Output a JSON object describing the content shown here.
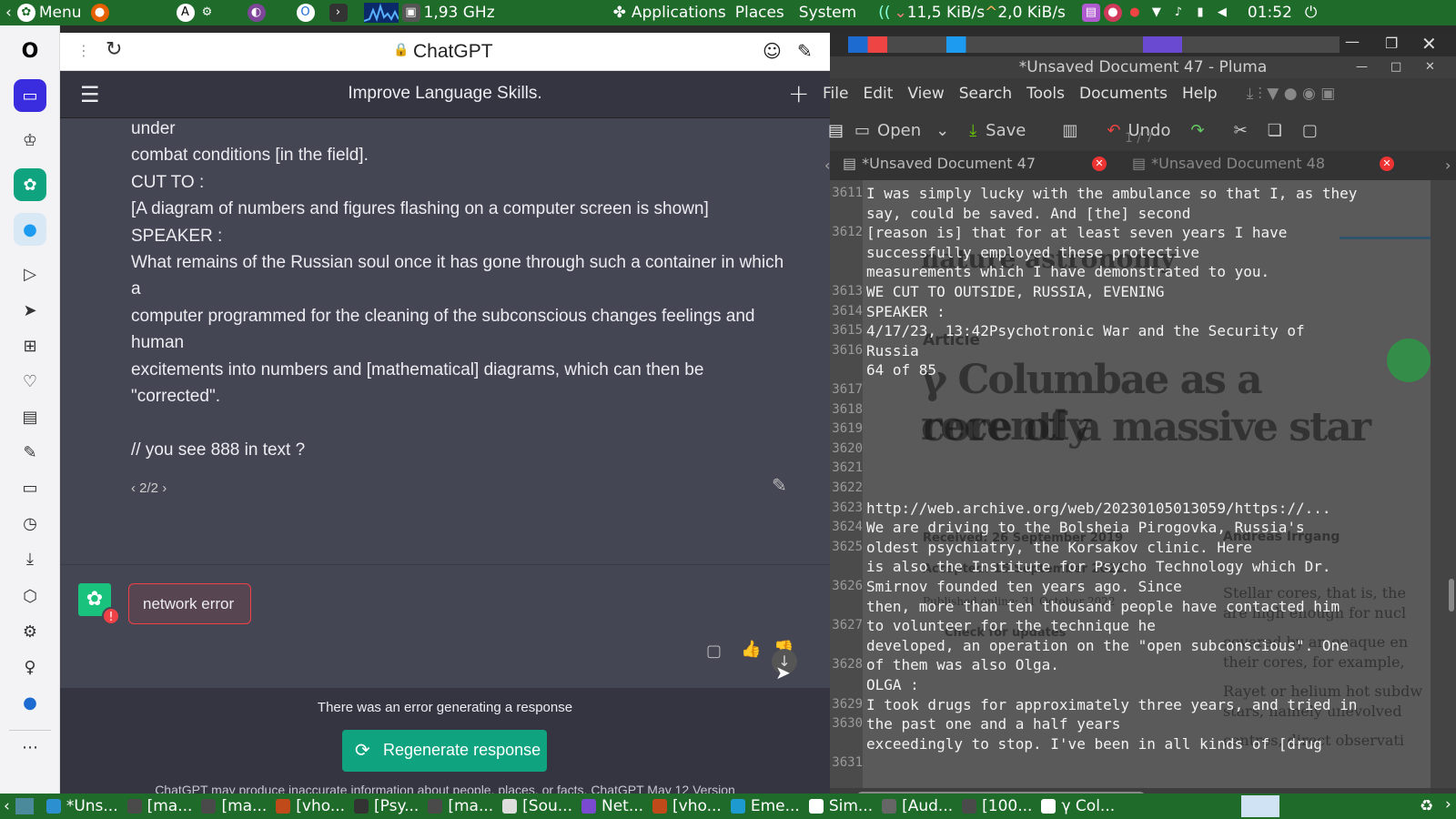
{
  "top_panel": {
    "menu_label": "Menu",
    "cpu_freq": "1,93 GHz",
    "applications": "Applications",
    "places": "Places",
    "system": "System",
    "net_down": "11,5 KiB/s",
    "net_up": "2,0 KiB/s",
    "clock": "01:52"
  },
  "browser": {
    "page_title": "ChatGPT",
    "chat_title": "Improve Language Skills.",
    "message_lines": [
      "under",
      "combat conditions [in the field].",
      "CUT TO :",
      "[A diagram of numbers and figures flashing on a computer screen is shown]",
      "SPEAKER :",
      "What remains of the Russian soul once it has gone through such a container in which",
      "a",
      "computer programmed for the cleaning of the subconscious changes feelings and",
      "human",
      "excitements into numbers and [mathematical] diagrams, which can then be",
      "\"corrected\".",
      "",
      "// you see 888 in text ?"
    ],
    "pager": "2/2",
    "error_badge": "network error",
    "error_notice": "There was an error generating a response",
    "regenerate_label": "Regenerate response",
    "disclaimer": "ChatGPT may produce inaccurate information about people, places, or facts.",
    "version_link": "ChatGPT May 12 Version"
  },
  "pluma": {
    "title": "*Unsaved Document 47 - Pluma",
    "menu": [
      "File",
      "Edit",
      "View",
      "Search",
      "Tools",
      "Documents",
      "Help"
    ],
    "open_label": "Open",
    "save_label": "Save",
    "undo_label": "Undo",
    "page_indicator": "1 / 7",
    "doc_tab_1": "*Unsaved Document 47",
    "doc_tab_2": "*Unsaved Document 48",
    "lines": [
      {
        "n": "3611",
        "t": "I was simply lucky with the ambulance so that I, as they"
      },
      {
        "n": "",
        "t": "say, could be saved. And [the] second"
      },
      {
        "n": "3612",
        "t": "[reason is] that for at least seven years I have"
      },
      {
        "n": "",
        "t": "successfully employed these protective"
      },
      {
        "n": "",
        "t": "measurements which I have demonstrated to you."
      },
      {
        "n": "3613",
        "t": "WE CUT TO OUTSIDE, RUSSIA, EVENING"
      },
      {
        "n": "3614",
        "t": "SPEAKER :"
      },
      {
        "n": "3615",
        "t": "4/17/23, 13:42Psychotronic War and the Security of"
      },
      {
        "n": "3616",
        "t": "Russia"
      },
      {
        "n": "",
        "t": "64 of 85"
      },
      {
        "n": "3617",
        "t": ""
      },
      {
        "n": "3618",
        "t": ""
      },
      {
        "n": "3619",
        "t": ""
      },
      {
        "n": "3620",
        "t": ""
      },
      {
        "n": "3621",
        "t": ""
      },
      {
        "n": "3622",
        "t": ""
      },
      {
        "n": "3623",
        "t": "http://web.archive.org/web/20230105013059/https://..."
      },
      {
        "n": "3624",
        "t": "We are driving to the Bolsheia Pirogovka, Russia's"
      },
      {
        "n": "3625",
        "t": "oldest psychiatry, the Korsakov clinic. Here"
      },
      {
        "n": "",
        "t": "is also the Institute for Psycho Technology which Dr."
      },
      {
        "n": "3626",
        "t": "Smirnov founded ten years ago. Since"
      },
      {
        "n": "",
        "t": "then, more than ten thousand people have contacted him"
      },
      {
        "n": "3627",
        "t": "to volunteer for the technique he"
      },
      {
        "n": "",
        "t": "developed, an operation on the \"open subconscious\". One"
      },
      {
        "n": "3628",
        "t": "of them was also Olga."
      },
      {
        "n": "",
        "t": "OLGA :"
      },
      {
        "n": "3629",
        "t": "I took drugs for approximately three years, and tried in"
      },
      {
        "n": "3630",
        "t": "the past one and a half years"
      },
      {
        "n": "",
        "t": "exceedingly to stop. I've been in all kinds of [drug"
      },
      {
        "n": "3631",
        "t": ""
      }
    ],
    "ghost": {
      "heading": "nature astronomy",
      "article": "Article",
      "headline_1": "γ Columbae as a recently",
      "headline_2": "core of a massive star",
      "received": "Received: 26 September 2019",
      "accepted": "Accepted: 15 September 2022",
      "published": "Published online: 31 October 2022",
      "updates": "Check for updates",
      "author": "Andreas Irrgang",
      "col_1": "Stellar cores, that is, the",
      "col_2": "are high enough for nucl",
      "col_3": "covered by an opaque en",
      "col_4": "their cores, for example,",
      "col_5": "Rayet or helium hot subdw",
      "col_6": "stars, namely unevolved",
      "col_7": "centres, direct observati"
    }
  },
  "taskbar": [
    "*Uns...",
    "[ma...",
    "[ma...",
    "[vho...",
    "[Psy...",
    "[ma...",
    "[Sou...",
    "Net...",
    "[vho...",
    "Eme...",
    "Sim...",
    "[Aud...",
    "[100...",
    "γ Col..."
  ],
  "colors": {
    "panel_green": "#1f6b2a",
    "chat_bg": "#343541",
    "message_bg": "#444654",
    "regenerate_green": "#10a37f",
    "error_red": "#ef4146"
  }
}
